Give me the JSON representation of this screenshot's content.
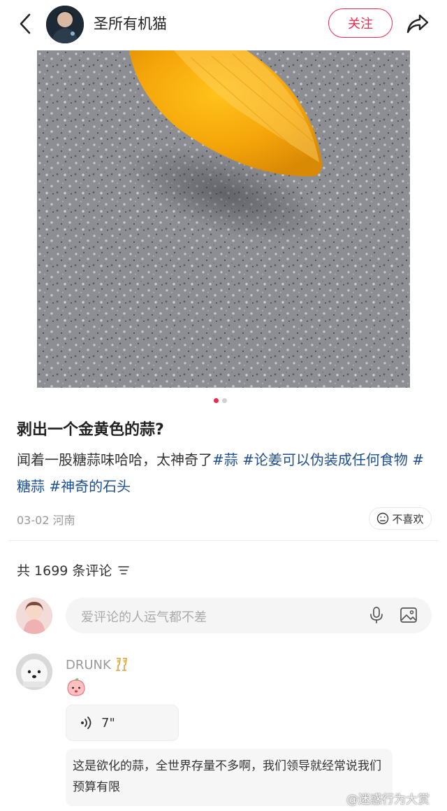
{
  "header": {
    "author_name": "圣所有机猫",
    "follow_label": "关注"
  },
  "carousel": {
    "current": 1,
    "total": 2
  },
  "post": {
    "title": "剥出一个金黄色的蒜?",
    "body_text": "闻着一股糖蒜味哈哈，太神奇了",
    "tags": [
      "#蒜",
      "#论姜可以伪装成任何食物",
      "#糖蒜",
      "#神奇的石头"
    ],
    "date": "03-02",
    "location": "河南",
    "dislike_label": "不喜欢"
  },
  "comments": {
    "count_label": "共 1699 条评论",
    "input_placeholder": "爱评论的人运气都不差",
    "items": [
      {
        "username": "DRUNK",
        "voice_duration": "7\"",
        "reply_text": "这是欲化的蒜，全世界存量不多啊，我们领导就经常说我们预算有限"
      }
    ]
  },
  "watermark": "@迷惑行为大赏",
  "colors": {
    "accent": "#ee2a4a",
    "tag": "#1f4f8f"
  }
}
